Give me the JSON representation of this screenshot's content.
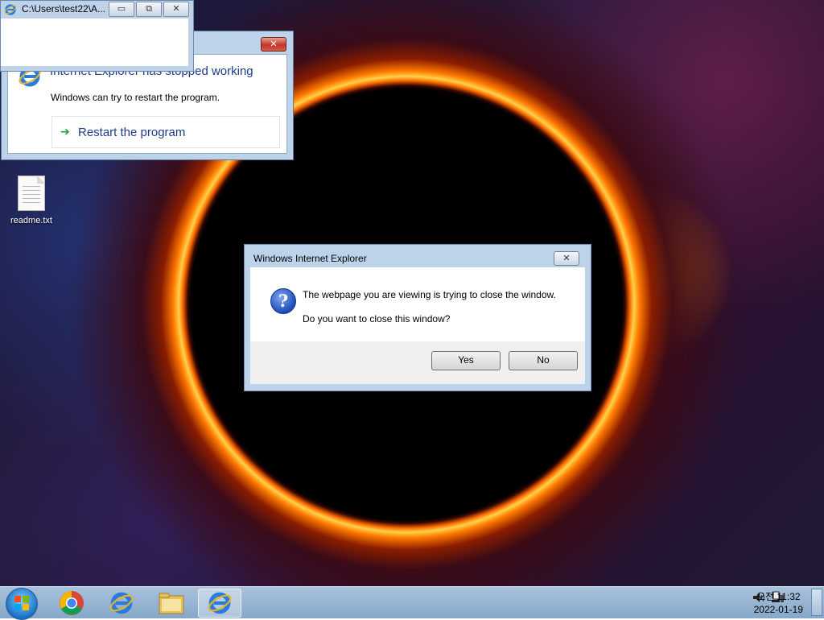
{
  "desktop": {
    "icons": [
      {
        "label": "readme.txt",
        "icon": "text-file-icon"
      }
    ]
  },
  "cmd_window": {
    "title": "C:\\Users\\test22\\A...",
    "buttons": {
      "minimize": "▭",
      "restore": "⧉",
      "close": "✕"
    }
  },
  "crash_dialog": {
    "heading": "Internet Explorer has stopped working",
    "message": "Windows can try to restart the program.",
    "restart_label": "Restart the program",
    "close_glyph": "✕"
  },
  "dialog": {
    "title": "Windows Internet Explorer",
    "close_glyph": "✕",
    "message1": "The webpage you are viewing is trying to close the window.",
    "message2": "Do you want to close this window?",
    "yes_label": "Yes",
    "no_label": "No",
    "icon": "question-icon"
  },
  "taskbar": {
    "items": [
      "start-orb-icon",
      "chrome-icon",
      "internet-explorer-icon",
      "file-explorer-icon",
      "internet-explorer-icon"
    ],
    "tray_icons": [
      "volume-icon",
      "network-icon"
    ],
    "time": "오전 11:32",
    "date": "2022-01-19"
  }
}
